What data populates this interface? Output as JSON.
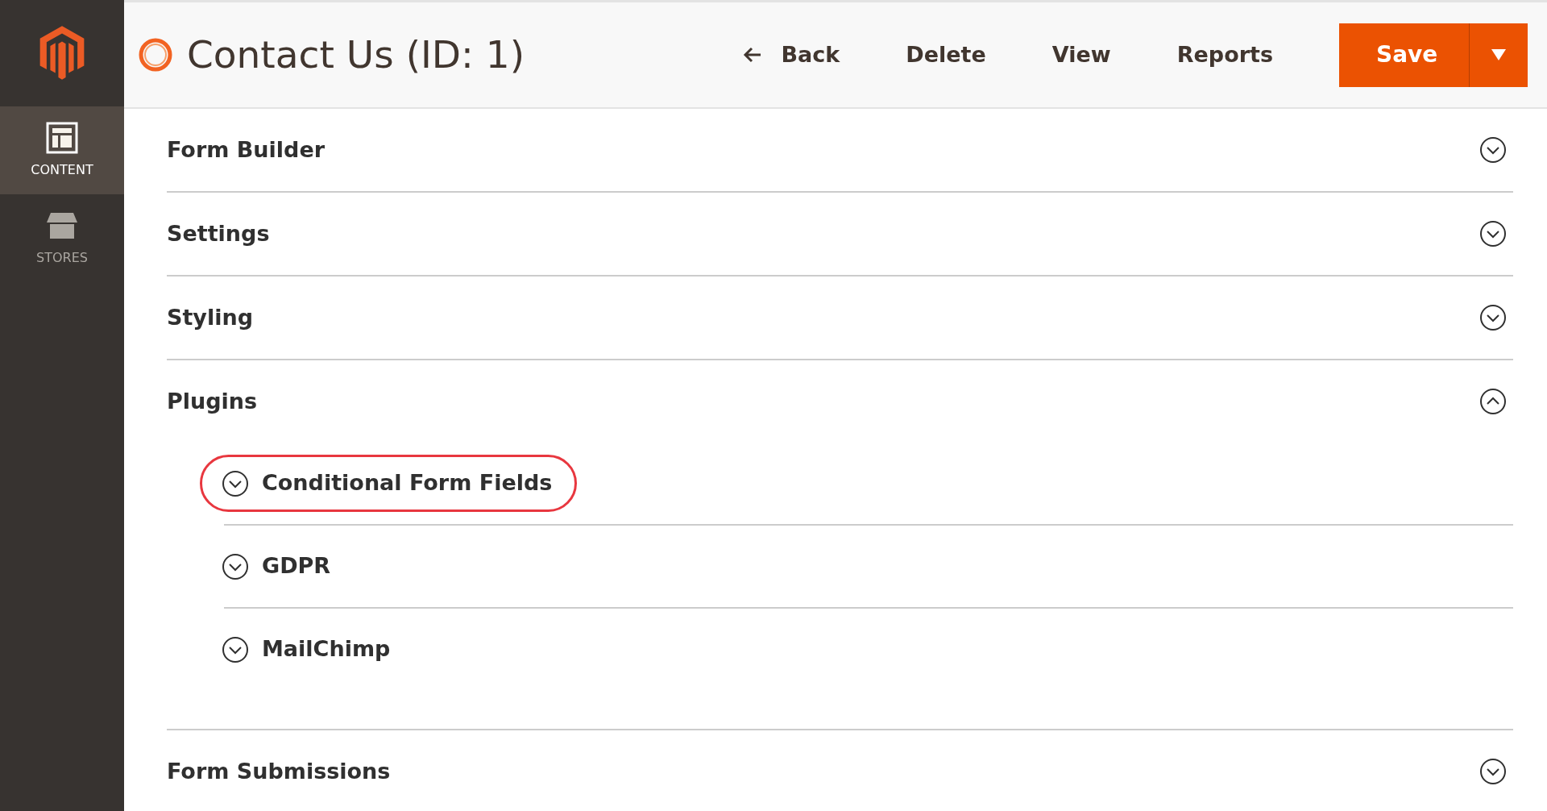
{
  "sidebar": {
    "items": [
      {
        "label": "CONTENT",
        "kind": "layout",
        "selected": true
      },
      {
        "label": "STORES",
        "kind": "store",
        "selected": false
      }
    ]
  },
  "header": {
    "title": "Contact Us (ID: 1)",
    "actions": [
      {
        "label": "Back",
        "kind": "back"
      },
      {
        "label": "Delete",
        "kind": "link"
      },
      {
        "label": "View",
        "kind": "link"
      },
      {
        "label": "Reports",
        "kind": "link"
      },
      {
        "label": "Save",
        "kind": "split"
      }
    ]
  },
  "sections": [
    {
      "title": "Form Builder",
      "expanded": false
    },
    {
      "title": "Settings",
      "expanded": false
    },
    {
      "title": "Styling",
      "expanded": false
    },
    {
      "title": "Plugins",
      "expanded": true,
      "children": [
        {
          "title": "Conditional Form Fields",
          "expanded": false,
          "highlighted": true
        },
        {
          "title": "GDPR",
          "expanded": false,
          "highlighted": false
        },
        {
          "title": "MailChimp",
          "expanded": false,
          "highlighted": false
        }
      ]
    },
    {
      "title": "Form Submissions",
      "expanded": false
    }
  ]
}
